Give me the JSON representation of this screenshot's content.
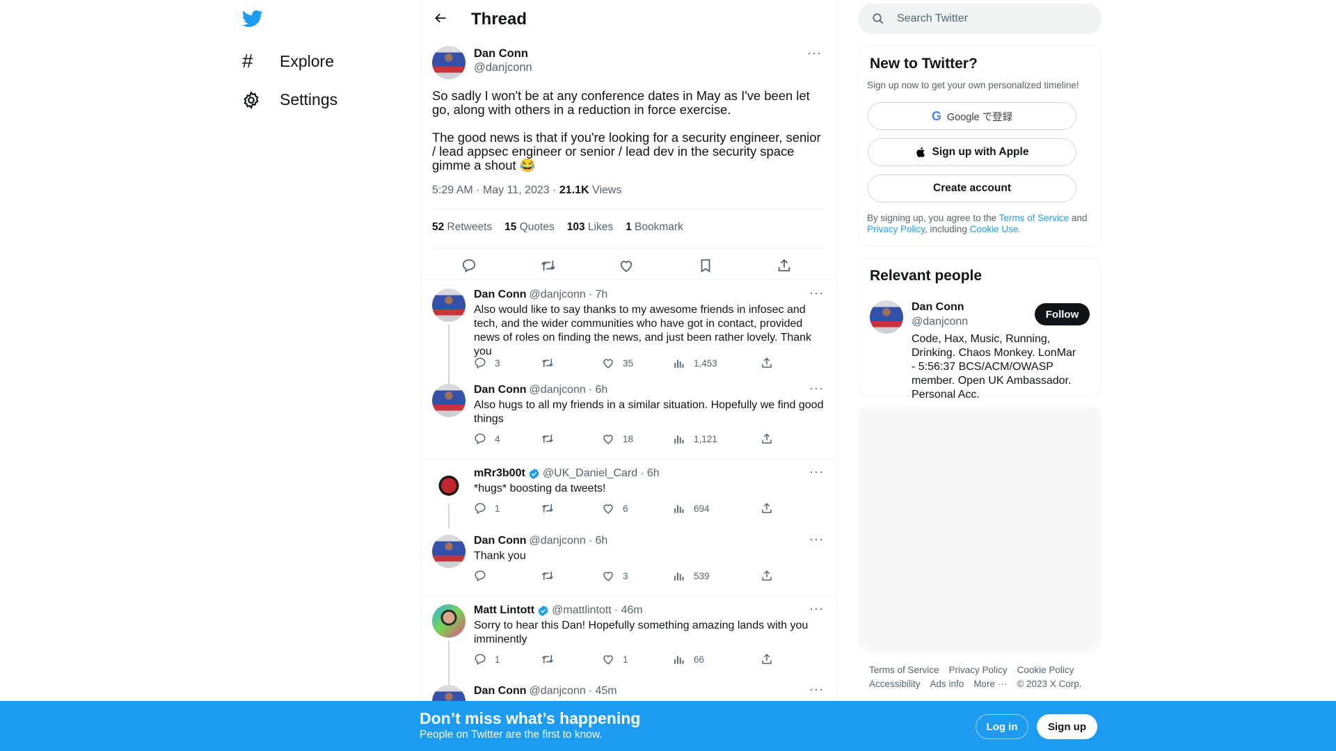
{
  "nav": {
    "logo": "twitter-bird-icon",
    "items": [
      {
        "label": "Explore",
        "icon": "hashtag-icon"
      },
      {
        "label": "Settings",
        "icon": "gear-icon"
      }
    ]
  },
  "header": {
    "title": "Thread"
  },
  "main_tweet": {
    "name": "Dan Conn",
    "handle": "@danjconn",
    "text_p1": "So sadly I won't be at any conference dates in May as I've been let go, along with others in a reduction in force exercise.",
    "text_p2": "The good news is that if you're looking for a security engineer, senior / lead appsec engineer or senior / lead dev in the security space gimme a shout",
    "emoji": "😂",
    "time": "5:29 AM · May 11, 2023 · ",
    "views_count": "21.1K",
    "views_label": " Views",
    "stats": [
      {
        "n": "52",
        "l": " Retweets"
      },
      {
        "n": "15",
        "l": " Quotes"
      },
      {
        "n": "103",
        "l": " Likes"
      },
      {
        "n": "1",
        "l": " Bookmark"
      }
    ]
  },
  "replies": [
    {
      "name": "Dan Conn",
      "verified": false,
      "handle": "@danjconn",
      "time": "· 7h",
      "text": "Also would like to say thanks to my awesome friends in infosec and tech, and the wider communities who have got in contact, provided news of roles on finding the news, and just been rather lovely. Thank you",
      "replies": "3",
      "retweets": "",
      "likes": "35",
      "views": "1,453"
    },
    {
      "name": "Dan Conn",
      "verified": false,
      "handle": "@danjconn",
      "time": "· 6h",
      "text": "Also hugs to all my friends in a similar situation. Hopefully we find good things",
      "replies": "4",
      "retweets": "",
      "likes": "18",
      "views": "1,121"
    },
    {
      "name": "mRr3b00t",
      "verified": true,
      "handle": "@UK_Daniel_Card",
      "time": "· 6h",
      "text": "*hugs* boosting da tweets!",
      "replies": "1",
      "retweets": "",
      "likes": "6",
      "views": "694"
    },
    {
      "name": "Dan Conn",
      "verified": false,
      "handle": "@danjconn",
      "time": "· 6h",
      "text": "Thank you",
      "replies": "",
      "retweets": "",
      "likes": "3",
      "views": "539"
    },
    {
      "name": "Matt Lintott",
      "verified": true,
      "handle": "@mattlintott",
      "time": "· 46m",
      "text": "Sorry to hear this Dan! Hopefully something amazing lands with you imminently",
      "replies": "1",
      "retweets": "",
      "likes": "1",
      "views": "66"
    },
    {
      "name": "Dan Conn",
      "verified": false,
      "handle": "@danjconn",
      "time": "· 45m",
      "text": "",
      "replies": "",
      "retweets": "",
      "likes": "",
      "views": ""
    }
  ],
  "search": {
    "placeholder": "Search Twitter"
  },
  "signup": {
    "title": "New to Twitter?",
    "subtitle": "Sign up now to get your own personalized timeline!",
    "google": "Google で登録",
    "apple": "Sign up with Apple",
    "create": "Create account",
    "legal_1": "By signing up, you agree to the ",
    "tos": "Terms of Service",
    "legal_2": " and ",
    "privacy": "Privacy Policy",
    "legal_3": ", including ",
    "cookie": "Cookie Use."
  },
  "relevant": {
    "title": "Relevant people",
    "name": "Dan Conn",
    "handle": "@danjconn",
    "follow": "Follow",
    "bio": "Code, Hax, Music, Running, Drinking. Chaos Monkey. LonMar      - 5:56:37 BCS/ACM/OWASP member. Open UK Ambassador. Personal Acc."
  },
  "footer": {
    "links": [
      "Terms of Service",
      "Privacy Policy",
      "Cookie Policy",
      "Accessibility",
      "Ads info",
      "More ···"
    ],
    "copyright": "© 2023 X Corp."
  },
  "banner": {
    "title": "Don’t miss what’s happening",
    "subtitle": "People on Twitter are the first to know.",
    "login": "Log in",
    "signup": "Sign up"
  },
  "colors": {
    "brand": "#1d9bf0",
    "text": "#0f1419",
    "muted": "#536471"
  }
}
